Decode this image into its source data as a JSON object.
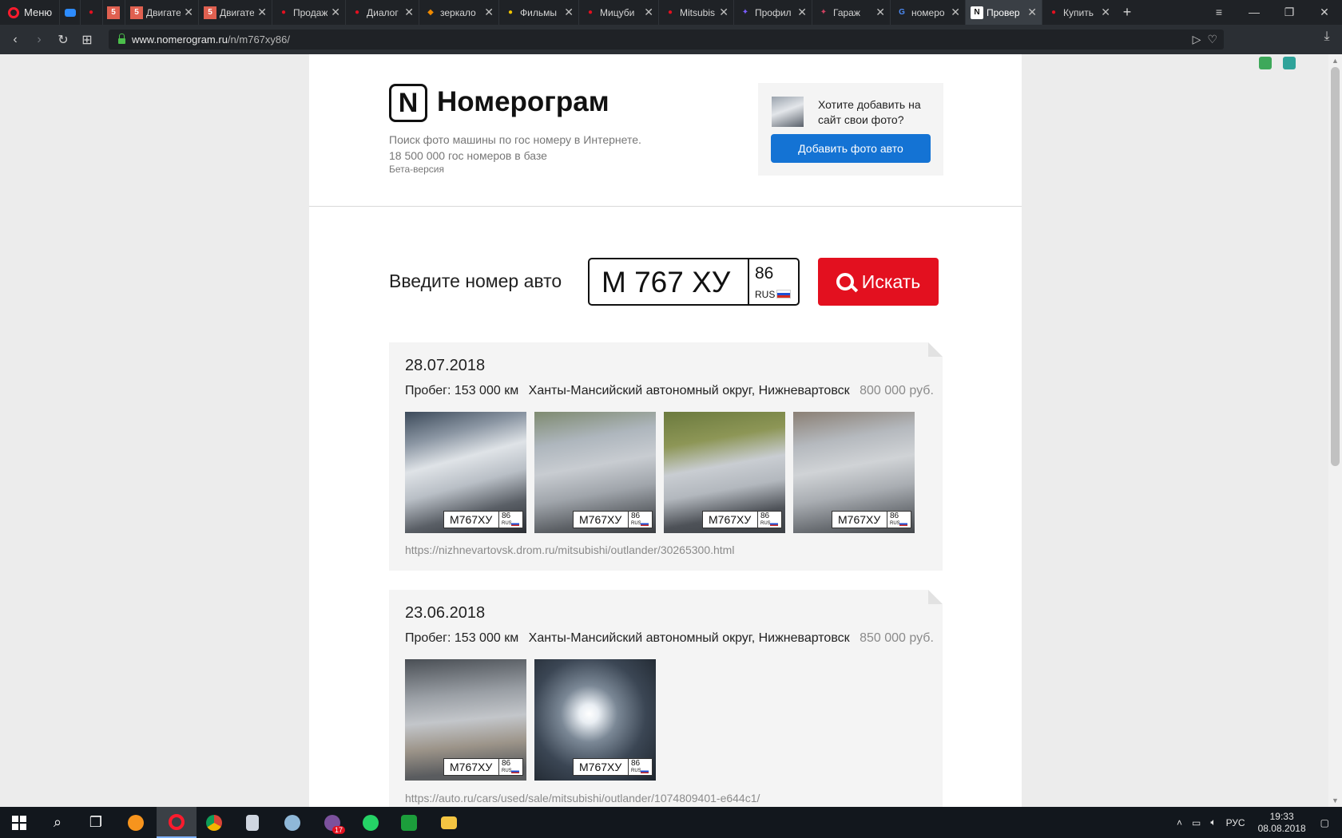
{
  "browser": {
    "menu_label": "Меню",
    "tabs": [
      {
        "title": "",
        "favicon_color": "#2d8cff"
      },
      {
        "title": "",
        "favicon_color": "#e3101f"
      },
      {
        "title": "",
        "favicon_color": "#e06050"
      },
      {
        "title": "Двигате",
        "favicon_color": "#e06050"
      },
      {
        "title": "Двигате",
        "favicon_color": "#e06050"
      },
      {
        "title": "Продаж",
        "favicon_color": "#e3101f"
      },
      {
        "title": "Диалог",
        "favicon_color": "#e3101f"
      },
      {
        "title": "зеркало",
        "favicon_color": "#f08a00"
      },
      {
        "title": "Фильмы",
        "favicon_color": "#f0c400"
      },
      {
        "title": "Мицуби",
        "favicon_color": "#e3101f"
      },
      {
        "title": "Mitsubis",
        "favicon_color": "#e3101f"
      },
      {
        "title": "Профил",
        "favicon_color": "#7a5cff"
      },
      {
        "title": "Гараж",
        "favicon_color": "#d04060"
      },
      {
        "title": "номеро",
        "favicon_color": "#4c8bf5"
      },
      {
        "title": "Провер",
        "favicon_color": "#ffffff",
        "active": true
      },
      {
        "title": "Купить",
        "favicon_color": "#e3101f"
      }
    ],
    "url_host": "www.nomerogram.ru",
    "url_path": "/n/m767xy86/"
  },
  "site": {
    "logo_letter": "N",
    "name": "Номерограм",
    "tagline_1": "Поиск фото машины по гос номеру в Интернете.",
    "tagline_2": "18 500 000 гос номеров в базе",
    "beta": "Бета-версия",
    "promo_text": "Хотите добавить на сайт свои фото?",
    "promo_button": "Добавить фото авто"
  },
  "search": {
    "label": "Введите номер авто",
    "plate_value": "М 767 ХУ",
    "region": "86",
    "country": "RUS",
    "button": "Искать"
  },
  "results": [
    {
      "date": "28.07.2018",
      "mileage": "Пробег: 153 000 км",
      "location": "Ханты-Мансийский автономный округ, Нижневартовск",
      "price": "800 000 руб.",
      "link": "https://nizhnevartovsk.drom.ru/mitsubishi/outlander/30265300.html",
      "photos": [
        {
          "plate": "М767ХУ",
          "region": "86",
          "country": "RUS"
        },
        {
          "plate": "М767ХУ",
          "region": "86",
          "country": "RUS"
        },
        {
          "plate": "М767ХУ",
          "region": "86",
          "country": "RUS"
        },
        {
          "plate": "М767ХУ",
          "region": "86",
          "country": "RUS"
        }
      ]
    },
    {
      "date": "23.06.2018",
      "mileage": "Пробег: 153 000 км",
      "location": "Ханты-Мансийский автономный округ, Нижневартовск",
      "price": "850 000 руб.",
      "link": "https://auto.ru/cars/used/sale/mitsubishi/outlander/1074809401-e644c1/",
      "photos": [
        {
          "plate": "М767ХУ",
          "region": "86",
          "country": "RUS"
        },
        {
          "plate": "М767ХУ",
          "region": "86",
          "country": "RUS"
        }
      ]
    }
  ],
  "taskbar": {
    "lang": "РУС",
    "time": "19:33",
    "date": "08.08.2018",
    "whatsapp_badge": "17"
  }
}
